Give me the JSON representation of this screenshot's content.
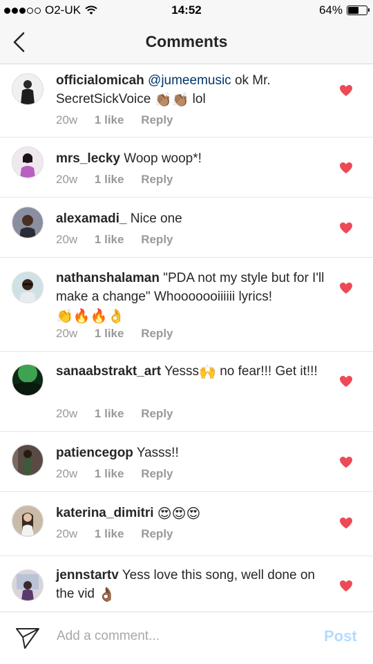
{
  "status_bar": {
    "carrier": "O2-UK",
    "time": "14:52",
    "battery": "64%",
    "battery_level": 0.64
  },
  "header": {
    "title": "Comments"
  },
  "colors": {
    "heart": "#ed4956",
    "mention": "#003569",
    "post_disabled": "#b3dbff"
  },
  "comments": [
    {
      "user": "officialomicah",
      "mention": "@jumeemusic",
      "text": " ok Mr. SecretSickVoice ",
      "emoji": "👏🏽👏🏽",
      "text_after": " lol",
      "time": "20w",
      "likes": "1 like",
      "reply": "Reply",
      "liked": true
    },
    {
      "user": "mrs_lecky",
      "text": "Woop woop*!",
      "time": "20w",
      "likes": "1 like",
      "reply": "Reply",
      "liked": true
    },
    {
      "user": "alexamadi_",
      "text": "Nice one",
      "time": "20w",
      "likes": "1 like",
      "reply": "Reply",
      "liked": true
    },
    {
      "user": "nathanshalaman",
      "text": "\"PDA not my style but for I'll make a change\" Whooooooiiiiii lyrics! ",
      "emoji": "👏🔥🔥👌",
      "time": "20w",
      "likes": "1 like",
      "reply": "Reply",
      "liked": true
    },
    {
      "user": "sanaabstrakt_art",
      "text": "Yesss",
      "emoji": "🙌",
      "text_after": " no fear!!! Get it!!!",
      "time": "20w",
      "likes": "1 like",
      "reply": "Reply",
      "liked": true
    },
    {
      "user": "patiencegop",
      "text": "Yasss!!",
      "time": "20w",
      "likes": "1 like",
      "reply": "Reply",
      "liked": true
    },
    {
      "user": "katerina_dimitri",
      "text": "",
      "emoji": "😍😍😍",
      "time": "20w",
      "likes": "1 like",
      "reply": "Reply",
      "liked": true
    },
    {
      "user": "jennstartv",
      "text": "Yess love this song, well done on the vid ",
      "emoji": "👌🏾",
      "liked": true
    }
  ],
  "composer": {
    "placeholder": "Add a comment...",
    "post_label": "Post"
  }
}
